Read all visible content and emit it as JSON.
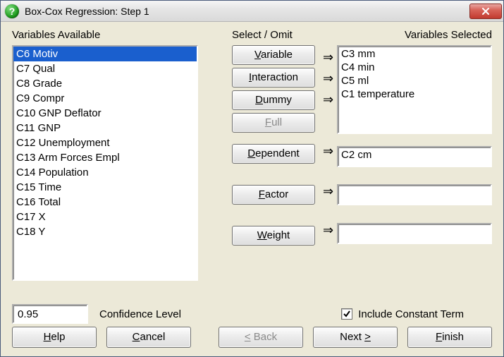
{
  "window": {
    "title": "Box-Cox Regression: Step 1",
    "icon_glyph": "?"
  },
  "labels": {
    "available": "Variables Available",
    "select_omit": "Select / Omit",
    "selected": "Variables Selected",
    "confidence": "Confidence Level",
    "include_const": "Include Constant Term"
  },
  "available_list": [
    "C6 Motiv",
    "C7 Qual",
    "C8 Grade",
    "C9 Compr",
    "C10 GNP Deflator",
    "C11 GNP",
    "C12 Unemployment",
    "C13 Arm Forces Empl",
    "C14 Population",
    "C15 Time",
    "C16 Total",
    "C17 X",
    "C18 Y"
  ],
  "available_selected_index": 0,
  "buttons": {
    "variable": "ariable",
    "interaction": "nteraction",
    "dummy": "ummy",
    "full": "ull",
    "dependent": "ependent",
    "factor": "actor",
    "weight": "eight"
  },
  "button_hot": {
    "variable": "V",
    "interaction": "I",
    "dummy": "D",
    "full": "F",
    "dependent": "D",
    "factor": "F",
    "weight": "W"
  },
  "selected_vars": [
    "C3 mm",
    "C4 min",
    "C5 ml",
    "C1 temperature"
  ],
  "dependent": "C2 cm",
  "factor": "",
  "weight": "",
  "confidence_value": "0.95",
  "include_constant": true,
  "nav": {
    "help": "elp",
    "help_hot": "H",
    "cancel": "ancel",
    "cancel_hot": "C",
    "back": " Back",
    "back_prefix": "<",
    "next": "Next ",
    "next_suffix": ">",
    "next_hot": ">",
    "finish": "inish",
    "finish_hot": "F"
  }
}
